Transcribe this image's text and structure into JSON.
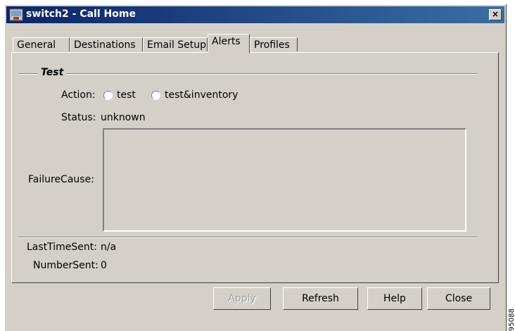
{
  "window": {
    "title": "switch2 - Call Home",
    "close_label": "×"
  },
  "tabs": [
    {
      "label": "General"
    },
    {
      "label": "Destinations"
    },
    {
      "label": "Email Setup"
    },
    {
      "label": "Alerts"
    },
    {
      "label": "Profiles"
    }
  ],
  "active_tab": "Alerts",
  "test_group": {
    "title": "Test",
    "action_label": "Action:",
    "options": [
      {
        "label": "test",
        "selected": false
      },
      {
        "label": "test&inventory",
        "selected": false
      }
    ],
    "status_label": "Status:",
    "status_value": "unknown",
    "failure_cause_label": "FailureCause:",
    "failure_cause_value": ""
  },
  "info": {
    "last_time_sent_label": "LastTimeSent:",
    "last_time_sent_value": "n/a",
    "number_sent_label": "NumberSent:",
    "number_sent_value": "0"
  },
  "buttons": {
    "apply": "Apply",
    "refresh": "Refresh",
    "help": "Help",
    "close": "Close"
  },
  "watermark": "95088",
  "colors": {
    "titlebar_start": "#0a246a",
    "titlebar_end": "#3a6ea5",
    "face": "#d4d0c8"
  }
}
